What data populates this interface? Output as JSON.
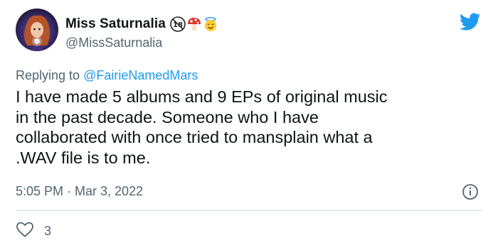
{
  "author": {
    "display_name": "Miss Saturnalia",
    "handle": "@MissSaturnalia",
    "badges": [
      "eighteen-plus-icon",
      "mushroom-icon",
      "smiling-face-with-halo-icon"
    ]
  },
  "reply": {
    "prefix": "Replying to ",
    "mention": "@FairieNamedMars"
  },
  "tweet": {
    "text": "I have made 5 albums and 9 EPs of original music\nin the past decade.  Someone who I have\ncollaborated with once tried to mansplain what a\n.WAV file is to me.",
    "timestamp": "5:05 PM · Mar 3, 2022"
  },
  "engagement": {
    "likes": "3"
  },
  "colors": {
    "accent": "#1d9bf0",
    "secondary_text": "#536471",
    "divider": "#cfd9de"
  }
}
